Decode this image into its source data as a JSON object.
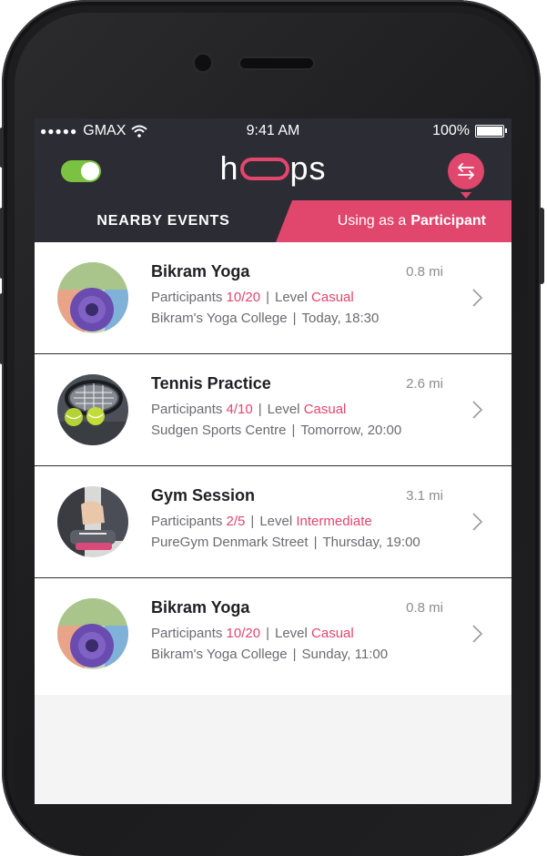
{
  "status_bar": {
    "signal_dots": "●●●●●",
    "carrier": "GMAX",
    "time": "9:41 AM",
    "battery_percent": "100%"
  },
  "header": {
    "toggle_on": true,
    "logo_text_left": "h",
    "logo_text_right": "ps",
    "swap_icon": "swap-arrows-icon"
  },
  "tabs": {
    "nearby_label": "NEARBY EVENTS",
    "mode_prefix": "Using as a",
    "mode_role": "Participant"
  },
  "labels": {
    "participants": "Participants",
    "level": "Level"
  },
  "events": [
    {
      "title": "Bikram Yoga",
      "distance": "0.8 mi",
      "participants": "10/20",
      "level": "Casual",
      "venue": "Bikram's Yoga College",
      "when": "Today, 18:30",
      "image": "yoga-mats"
    },
    {
      "title": "Tennis Practice",
      "distance": "2.6 mi",
      "participants": "4/10",
      "level": "Casual",
      "venue": "Sudgen Sports Centre",
      "when": "Tomorrow, 20:00",
      "image": "tennis-racket"
    },
    {
      "title": "Gym Session",
      "distance": "3.1 mi",
      "participants": "2/5",
      "level": "Intermediate",
      "venue": "PureGym Denmark Street",
      "when": "Thursday, 19:00",
      "image": "gym-shoes"
    },
    {
      "title": "Bikram Yoga",
      "distance": "0.8 mi",
      "participants": "10/20",
      "level": "Casual",
      "venue": "Bikram's Yoga College",
      "when": "Sunday, 11:00",
      "image": "yoga-mats"
    }
  ],
  "colors": {
    "accent": "#e1466d",
    "dark": "#2b2c34",
    "toggle_green": "#7cc242"
  }
}
